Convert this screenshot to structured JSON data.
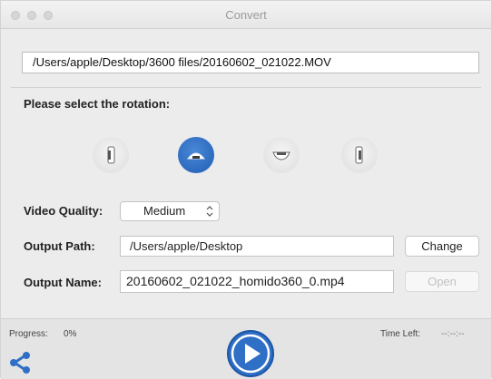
{
  "window": {
    "title": "Convert"
  },
  "input_path": "/Users/apple/Desktop/3600 files/20160602_021022.MOV",
  "rotation": {
    "label": "Please select the rotation:",
    "options": [
      {
        "icon": "rotate-left-icon",
        "selected": false
      },
      {
        "icon": "rotate-up-icon",
        "selected": true
      },
      {
        "icon": "rotate-down-icon",
        "selected": false
      },
      {
        "icon": "rotate-right-icon",
        "selected": false
      }
    ]
  },
  "video_quality": {
    "label": "Video Quality:",
    "value": "Medium"
  },
  "output_path": {
    "label": "Output  Path:",
    "value": "/Users/apple/Desktop",
    "button": "Change"
  },
  "output_name": {
    "label": "Output  Name:",
    "value": "20160602_021022_homido360_0.mp4",
    "button": "Open"
  },
  "footer": {
    "progress_label": "Progress:",
    "progress_value": "0%",
    "time_left_label": "Time Left:",
    "time_left_value": "--:--:--"
  },
  "colors": {
    "accent": "#2f6fc6",
    "background": "#ececec"
  }
}
